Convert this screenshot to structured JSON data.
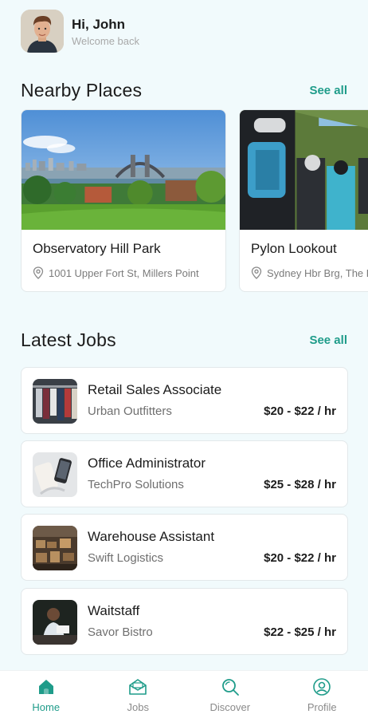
{
  "header": {
    "greeting": "Hi, John",
    "subtitle": "Welcome back"
  },
  "nearby": {
    "title": "Nearby Places",
    "see_all": "See all",
    "places": [
      {
        "name": "Observatory Hill Park",
        "address": "1001 Upper Fort St, Millers Point"
      },
      {
        "name": "Pylon Lookout",
        "address": "Sydney Hbr Brg, The Rocks"
      }
    ]
  },
  "jobs": {
    "title": "Latest Jobs",
    "see_all": "See all",
    "items": [
      {
        "title": "Retail Sales Associate",
        "company": "Urban Outfitters",
        "pay": "$20 - $22 / hr"
      },
      {
        "title": "Office Administrator",
        "company": "TechPro Solutions",
        "pay": "$25 - $28 / hr"
      },
      {
        "title": "Warehouse Assistant",
        "company": "Swift Logistics",
        "pay": "$20 - $22 / hr"
      },
      {
        "title": "Waitstaff",
        "company": "Savor Bistro",
        "pay": "$22 - $25 / hr"
      }
    ]
  },
  "nav": {
    "active": "Home",
    "items": [
      {
        "label": "Home",
        "icon": "home-icon"
      },
      {
        "label": "Jobs",
        "icon": "mail-icon"
      },
      {
        "label": "Discover",
        "icon": "search-icon"
      },
      {
        "label": "Profile",
        "icon": "profile-icon"
      }
    ]
  },
  "colors": {
    "accent": "#1f9c8a",
    "background": "#f1fafc",
    "card": "#ffffff",
    "text": "#1c1c1c"
  }
}
